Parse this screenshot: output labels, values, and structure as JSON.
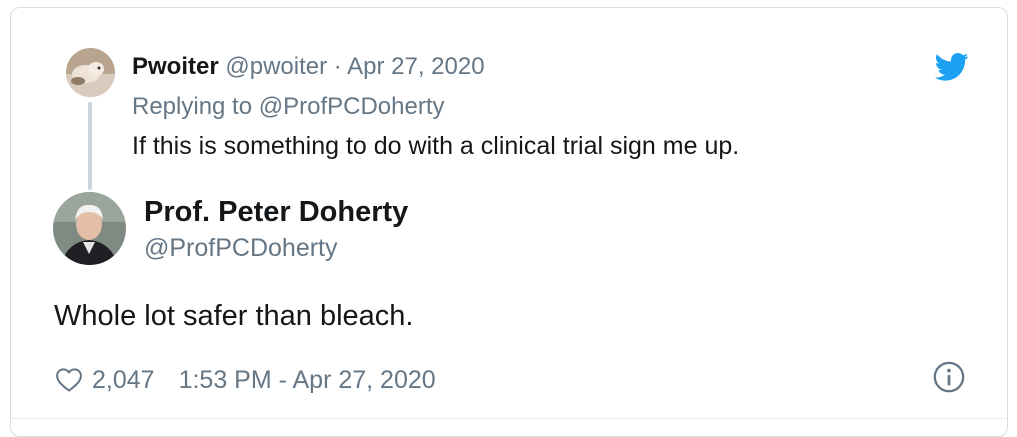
{
  "parent_tweet": {
    "display_name": "Pwoiter",
    "handle": "@pwoiter",
    "separator": "·",
    "date": "Apr 27, 2020",
    "replying_to_label": "Replying to",
    "replying_to_handle": "@ProfPCDoherty",
    "text": "If this is something to do with a clinical trial sign me up."
  },
  "tweet": {
    "display_name": "Prof. Peter Doherty",
    "handle": "@ProfPCDoherty",
    "text": "Whole lot safer than bleach.",
    "like_count": "2,047",
    "timestamp": "1:53 PM - Apr 27, 2020"
  },
  "icons": {
    "brand": "twitter-bird-icon",
    "like": "heart-icon",
    "info": "info-icon"
  },
  "colors": {
    "brand_blue": "#1da1f2",
    "muted_text": "#657786",
    "primary_text": "#14171a",
    "border": "#d6dde3",
    "thread_line": "#cdd5dc"
  }
}
